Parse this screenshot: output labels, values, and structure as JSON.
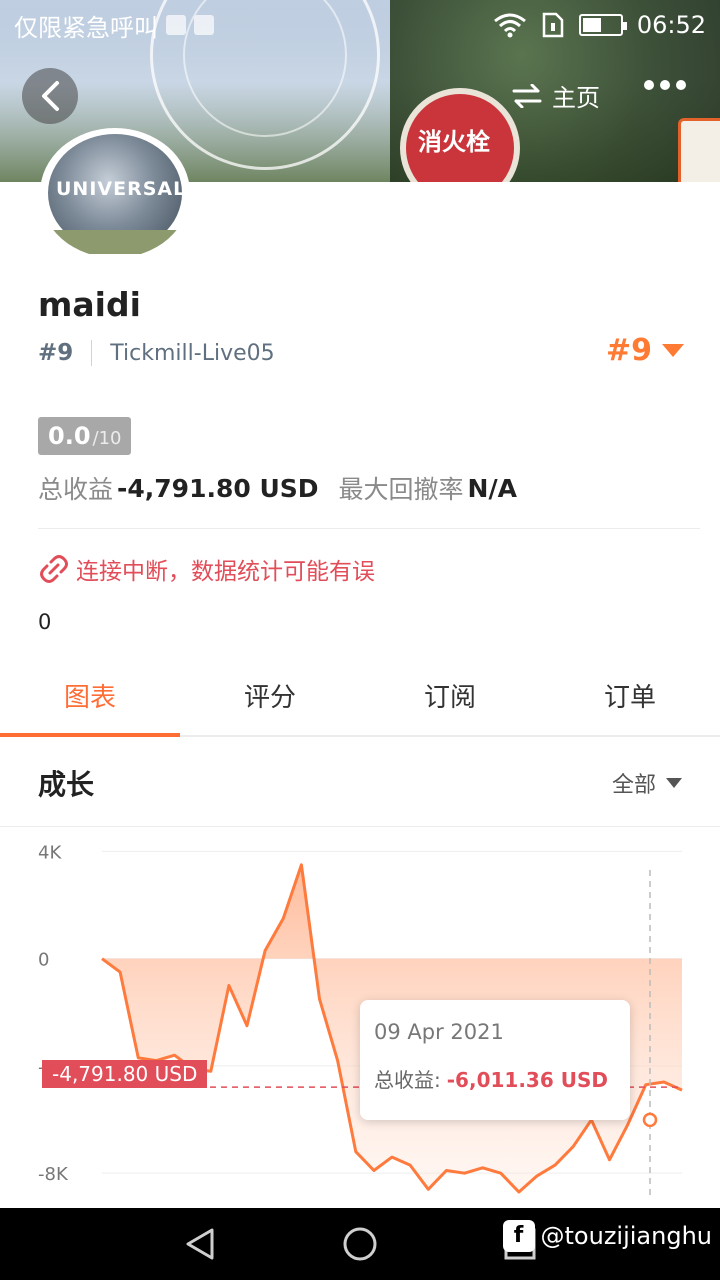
{
  "statusbar": {
    "carrier": "仅限紧急呼叫",
    "time": "06:52"
  },
  "header": {
    "home_label": "主页"
  },
  "profile": {
    "name": "maidi",
    "rank": "#9",
    "server": "Tickmill-Live05",
    "rank_badge": "#9",
    "score": "0.0",
    "score_max": "/10",
    "total_profit_label": "总收益",
    "total_profit_value": "-4,791.80 USD",
    "max_drawdown_label": "最大回撤率",
    "max_drawdown_value": "N/A",
    "warning": "连接中断，数据统计可能有误",
    "zero_value": "0"
  },
  "tabs": [
    {
      "label": "图表",
      "active": true
    },
    {
      "label": "评分",
      "active": false
    },
    {
      "label": "订阅",
      "active": false
    },
    {
      "label": "订单",
      "active": false
    }
  ],
  "section": {
    "title": "成长",
    "filter_label": "全部"
  },
  "chart_data": {
    "type": "area",
    "ylabel_ticks": [
      "4K",
      "0",
      "-4K",
      "-8K"
    ],
    "y_tick_values": [
      4000,
      0,
      -4000,
      -8000
    ],
    "ylim": [
      -9000,
      4500
    ],
    "series": [
      {
        "values": [
          0,
          -500,
          -3700,
          -3800,
          -3600,
          -4100,
          -4200,
          -1000,
          -2500,
          300,
          1500,
          3500,
          -1500,
          -3800,
          -7200,
          -7900,
          -7400,
          -7700,
          -8600,
          -7900,
          -8000,
          -7800,
          -8000,
          -8700,
          -8100,
          -7700,
          -7000,
          -6011.36,
          -7500,
          -6200,
          -4700,
          -4600,
          -4900
        ]
      }
    ],
    "current_value_label": "-4,791.80 USD",
    "current_value": -4791.8,
    "tooltip": {
      "date": "09 Apr 2021",
      "label": "总收益:",
      "value": "-6,011.36 USD"
    },
    "colors": {
      "line": "#ff7a3d",
      "fill_top": "#ffb08a",
      "fill_bottom": "#ffe8dc",
      "marker": "#e14d58"
    }
  },
  "watermark": "@touzijianghu"
}
